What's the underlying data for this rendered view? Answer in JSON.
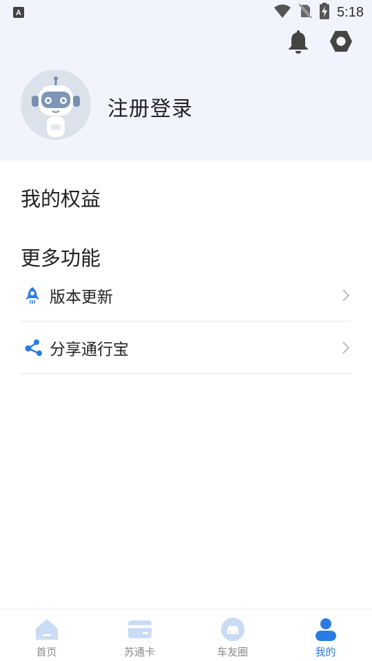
{
  "status_bar": {
    "time": "5:18"
  },
  "header": {
    "login_label": "注册登录"
  },
  "sections": {
    "rights_title": "我的权益",
    "more_title": "更多功能"
  },
  "menu": [
    {
      "label": "版本更新",
      "icon": "rocket-icon"
    },
    {
      "label": "分享通行宝",
      "icon": "share-icon"
    }
  ],
  "tabbar": [
    {
      "label": "首页",
      "icon": "home-icon",
      "active": false
    },
    {
      "label": "苏通卡",
      "icon": "card-icon",
      "active": false
    },
    {
      "label": "车友圈",
      "icon": "car-icon",
      "active": false
    },
    {
      "label": "我的",
      "icon": "person-icon",
      "active": true
    }
  ],
  "colors": {
    "accent": "#2a7be4",
    "header_bg": "#f2f4fd",
    "inactive_icon": "#c9dcf3"
  }
}
